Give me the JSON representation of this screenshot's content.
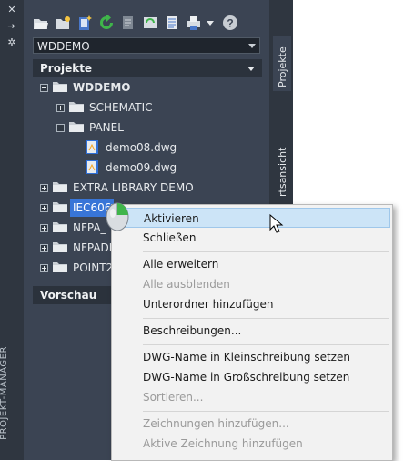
{
  "palette": {
    "title": "PROJEKT-MANAGER"
  },
  "toolbar": {
    "icons": [
      "open-project-icon",
      "new-project-icon",
      "new-drawing-icon",
      "refresh-icon",
      "task-list-icon",
      "rebuild-icon",
      "project-properties-icon",
      "plot-icon",
      "dropdown-icon",
      "help-icon"
    ]
  },
  "project_select": {
    "value": "WDDEMO"
  },
  "projects_section": {
    "title": "Projekte"
  },
  "tree": {
    "root": "WDDEMO",
    "schematic": "SCHEMATIC",
    "panel": "PANEL",
    "file1": "demo08.dwg",
    "file2": "demo09.dwg",
    "extra": "EXTRA LIBRARY DEMO",
    "iec": "IEC606",
    "nfpa1": "NFPA_",
    "nfpa2": "NFPADE",
    "point": "POINT2"
  },
  "preview_section": {
    "title": "Vorschau"
  },
  "right_tabs": {
    "projects": "Projekte",
    "view": "rtsansicht"
  },
  "context_menu": {
    "items": [
      {
        "label": "Aktivieren",
        "enabled": true,
        "highlighted": true
      },
      {
        "label": "Schließen",
        "enabled": true
      },
      {
        "label": "Alle erweitern",
        "enabled": true
      },
      {
        "label": "Alle ausblenden",
        "enabled": false
      },
      {
        "label": "Unterordner hinzufügen",
        "enabled": true
      },
      {
        "label": "Beschreibungen...",
        "enabled": true
      },
      {
        "label": "DWG-Name in Kleinschreibung setzen",
        "enabled": true
      },
      {
        "label": "DWG-Name in Großschreibung setzen",
        "enabled": true
      },
      {
        "label": "Sortieren...",
        "enabled": false
      },
      {
        "label": "Zeichnungen hinzufügen...",
        "enabled": false
      },
      {
        "label": "Aktive Zeichnung hinzufügen",
        "enabled": false
      }
    ]
  },
  "colors": {
    "panel_bg": "#3b4453",
    "strip_bg": "#2f3640",
    "selection": "#3875d7",
    "menu_highlight": "#cce4f7"
  }
}
